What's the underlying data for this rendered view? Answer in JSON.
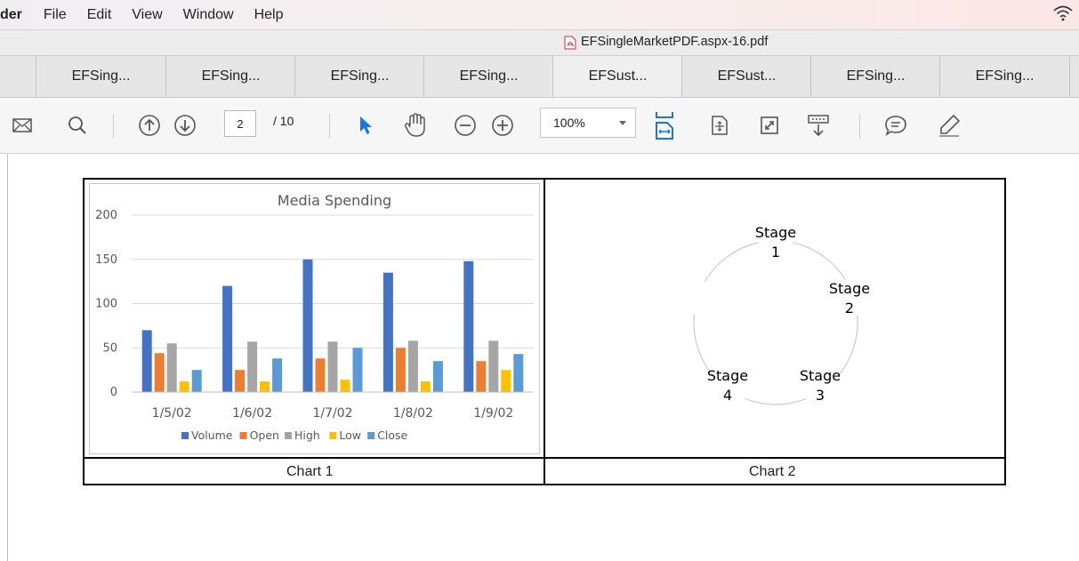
{
  "menubar": {
    "app_fragment": "der",
    "items": [
      "File",
      "Edit",
      "View",
      "Window",
      "Help"
    ]
  },
  "window": {
    "title": "EFSingleMarketPDF.aspx-16.pdf"
  },
  "tabs": [
    "EFSing...",
    "EFSing...",
    "EFSing...",
    "EFSing...",
    "EFSust...",
    "EFSust...",
    "EFSing...",
    "EFSing..."
  ],
  "toolbar": {
    "current_page": "2",
    "total_pages": "/ 10",
    "zoom": "100%",
    "accent_color": "#1a73e8"
  },
  "document": {
    "captions": [
      "Chart 1",
      "Chart 2"
    ]
  },
  "chart_data": [
    {
      "type": "bar",
      "title": "Media Spending",
      "categories": [
        "1/5/02",
        "1/6/02",
        "1/7/02",
        "1/8/02",
        "1/9/02"
      ],
      "ylim": [
        0,
        200
      ],
      "yticks": [
        "0",
        "50",
        "100",
        "150",
        "200"
      ],
      "grid": true,
      "legend": "bottom",
      "series": [
        {
          "name": "Volume",
          "color": "#4472c4",
          "values": [
            70,
            120,
            150,
            135,
            148
          ]
        },
        {
          "name": "Open",
          "color": "#ed7d31",
          "values": [
            44,
            25,
            38,
            50,
            35
          ]
        },
        {
          "name": "High",
          "color": "#a5a5a5",
          "values": [
            55,
            57,
            57,
            58,
            58
          ]
        },
        {
          "name": "Low",
          "color": "#ffc000",
          "values": [
            12,
            12,
            14,
            12,
            25
          ]
        },
        {
          "name": "Close",
          "color": "#5b9bd5",
          "values": [
            25,
            38,
            50,
            35,
            43
          ]
        }
      ]
    },
    {
      "type": "cycle",
      "stages": [
        {
          "line1": "Stage",
          "line2": "1"
        },
        {
          "line1": "Stage",
          "line2": "2"
        },
        {
          "line1": "Stage",
          "line2": "3"
        },
        {
          "line1": "Stage",
          "line2": "4"
        }
      ]
    }
  ]
}
